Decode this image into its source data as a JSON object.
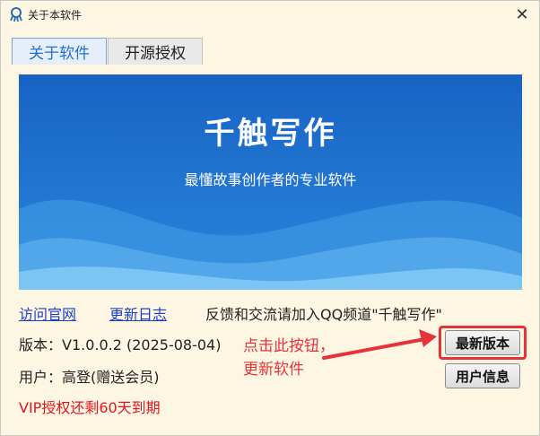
{
  "window": {
    "title": "关于本软件",
    "close_glyph": "✕"
  },
  "tabs": [
    {
      "label": "关于软件",
      "active": true
    },
    {
      "label": "开源授权",
      "active": false
    }
  ],
  "banner": {
    "title": "千触写作",
    "subtitle": "最懂故事创作者的专业软件"
  },
  "links": {
    "website": "访问官网",
    "changelog": "更新日志",
    "feedback": "反馈和交流请加入QQ频道\"千触写作\""
  },
  "info": {
    "version": "版本：V1.0.0.2 (2025-08-04)",
    "user": "用户：高登(赠送会员)",
    "vip": "VIP授权还剩60天到期"
  },
  "buttons": {
    "latest": "最新版本",
    "userinfo": "用户信息"
  },
  "annotation": {
    "line1": "点击此按钮，",
    "line2": "更新软件"
  },
  "colors": {
    "accent_red": "#e8323a",
    "link_blue": "#1a3fc9",
    "banner_blue": "#1a6ec8",
    "vip_red": "#e0161f"
  }
}
